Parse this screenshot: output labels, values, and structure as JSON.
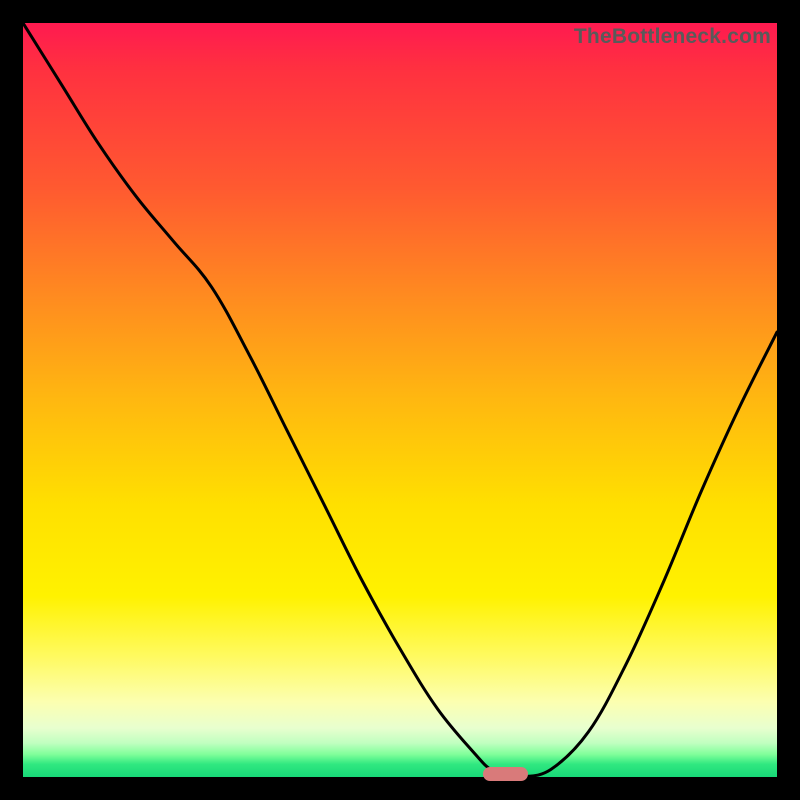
{
  "watermark": "TheBottleneck.com",
  "colors": {
    "frame_bg": "#000000",
    "gradient_top": "#ff1a50",
    "gradient_bottom": "#18d878",
    "curve_stroke": "#000000",
    "marker_fill": "#d97a7a",
    "watermark_text": "#5a5a5a"
  },
  "chart_data": {
    "type": "line",
    "title": "",
    "xlabel": "",
    "ylabel": "",
    "xlim": [
      0,
      100
    ],
    "ylim": [
      0,
      100
    ],
    "grid": false,
    "legend": false,
    "series": [
      {
        "name": "bottleneck-curve",
        "x": [
          0,
          5,
          10,
          15,
          20,
          25,
          30,
          35,
          40,
          45,
          50,
          55,
          60,
          62,
          64,
          66,
          70,
          75,
          80,
          85,
          90,
          95,
          100
        ],
        "y": [
          100,
          92,
          84,
          77,
          71,
          65,
          56,
          46,
          36,
          26,
          17,
          9,
          3,
          1,
          0,
          0,
          1,
          6,
          15,
          26,
          38,
          49,
          59
        ]
      }
    ],
    "marker": {
      "x_center": 64,
      "width_pct": 6,
      "y": 0
    },
    "background_gradient_stops": [
      {
        "pos": 0.0,
        "color": "#ff1a50"
      },
      {
        "pos": 0.06,
        "color": "#ff3040"
      },
      {
        "pos": 0.22,
        "color": "#ff5a30"
      },
      {
        "pos": 0.36,
        "color": "#ff8a20"
      },
      {
        "pos": 0.5,
        "color": "#ffb810"
      },
      {
        "pos": 0.64,
        "color": "#ffe000"
      },
      {
        "pos": 0.76,
        "color": "#fff200"
      },
      {
        "pos": 0.84,
        "color": "#fffa60"
      },
      {
        "pos": 0.9,
        "color": "#fcffb0"
      },
      {
        "pos": 0.935,
        "color": "#e8ffcf"
      },
      {
        "pos": 0.955,
        "color": "#c0ffc0"
      },
      {
        "pos": 0.97,
        "color": "#80ff9a"
      },
      {
        "pos": 0.983,
        "color": "#30e880"
      },
      {
        "pos": 1.0,
        "color": "#18d878"
      }
    ]
  }
}
